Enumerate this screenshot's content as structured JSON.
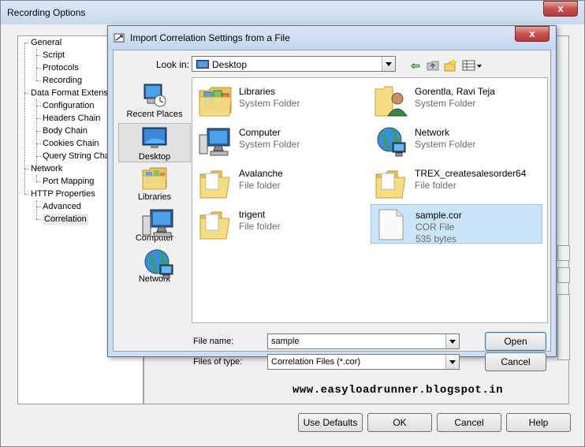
{
  "outer": {
    "title": "Recording Options",
    "close": "x",
    "tree": [
      {
        "label": "General",
        "level": 1
      },
      {
        "label": "Script",
        "level": 2
      },
      {
        "label": "Protocols",
        "level": 2
      },
      {
        "label": "Recording",
        "level": 2
      },
      {
        "label": "Data Format Extensio",
        "level": 1
      },
      {
        "label": "Configuration",
        "level": 2
      },
      {
        "label": "Headers Chain",
        "level": 2
      },
      {
        "label": "Body Chain",
        "level": 2
      },
      {
        "label": "Cookies Chain",
        "level": 2
      },
      {
        "label": "Query String Chai",
        "level": 2
      },
      {
        "label": "Network",
        "level": 1
      },
      {
        "label": "Port Mapping",
        "level": 2
      },
      {
        "label": "HTTP Properties",
        "level": 1
      },
      {
        "label": "Advanced",
        "level": 2
      },
      {
        "label": "Correlation",
        "level": 2
      }
    ],
    "selected_tree_item": "Correlation",
    "watermark": "www.easyloadrunner.blogspot.in",
    "buttons": {
      "use_defaults": "Use Defaults",
      "ok": "OK",
      "cancel": "Cancel",
      "help": "Help"
    }
  },
  "dialog": {
    "title": "Import Correlation Settings from a File",
    "close": "x",
    "look_in_label": "Look in:",
    "look_in_value": "Desktop",
    "places": [
      {
        "label": "Recent Places",
        "icon": "recent-places-icon"
      },
      {
        "label": "Desktop",
        "icon": "desktop-icon"
      },
      {
        "label": "Libraries",
        "icon": "libraries-icon"
      },
      {
        "label": "Computer",
        "icon": "computer-icon"
      },
      {
        "label": "Network",
        "icon": "network-icon"
      }
    ],
    "selected_place": "Desktop",
    "files": [
      {
        "name": "Libraries",
        "type": "System Folder",
        "icon": "libraries-folder-icon"
      },
      {
        "name": "Gorentla, Ravi Teja",
        "type": "System Folder",
        "icon": "user-folder-icon"
      },
      {
        "name": "Computer",
        "type": "System Folder",
        "icon": "computer-icon"
      },
      {
        "name": "Network",
        "type": "System Folder",
        "icon": "network-icon"
      },
      {
        "name": "Avalanche",
        "type": "File folder",
        "icon": "folder-icon"
      },
      {
        "name": "TREX_createsalesorder64",
        "type": "File folder",
        "icon": "folder-icon"
      },
      {
        "name": "trigent",
        "type": "File folder",
        "icon": "folder-icon"
      },
      {
        "name": "sample.cor",
        "type": "COR File",
        "size": "535 bytes",
        "icon": "file-icon"
      }
    ],
    "selected_file": "sample.cor",
    "file_name_label": "File name:",
    "file_name_value": "sample",
    "file_type_label": "Files of type:",
    "file_type_value": "Correlation Files (*.cor)",
    "open_button": "Open",
    "cancel_button": "Cancel"
  },
  "colors": {
    "selection": "#cce4f7",
    "folder": "#f3d36e",
    "title_bar": "#c7d8ec",
    "close_button": "#c75050"
  }
}
